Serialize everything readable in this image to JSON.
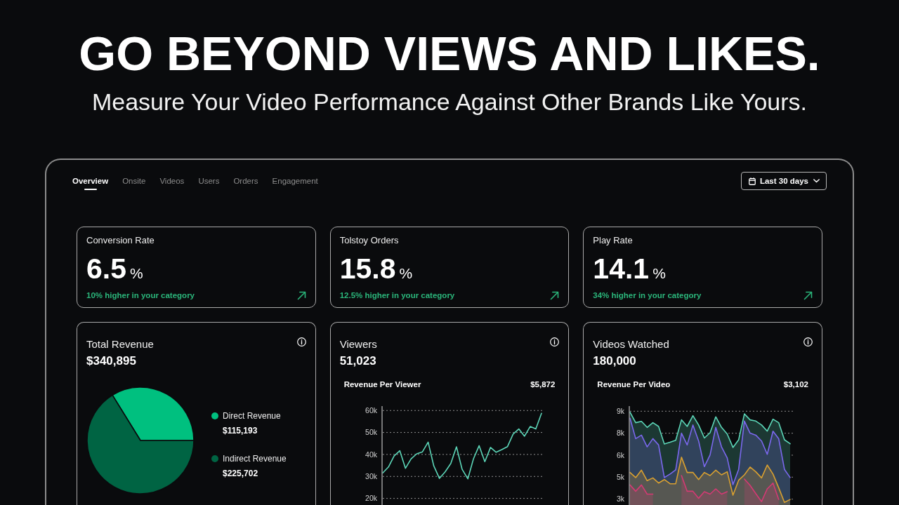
{
  "hero": {
    "title": "GO BEYOND VIEWS AND LIKES.",
    "subtitle": "Measure Your Video Performance Against Other Brands Like Yours."
  },
  "dashboard": {
    "tabs": [
      {
        "label": "Overview",
        "selected": true
      },
      {
        "label": "Onsite",
        "selected": false
      },
      {
        "label": "Videos",
        "selected": false
      },
      {
        "label": "Users",
        "selected": false
      },
      {
        "label": "Orders",
        "selected": false
      },
      {
        "label": "Engagement",
        "selected": false
      }
    ],
    "date_range": {
      "label": "Last 30 days"
    },
    "stat_cards": [
      {
        "title": "Conversion Rate",
        "value": "6.5",
        "unit": "%",
        "note": "10% higher in your category"
      },
      {
        "title": "Tolstoy Orders",
        "value": "15.8",
        "unit": "%",
        "note": "12.5% higher in your category"
      },
      {
        "title": "Play Rate",
        "value": "14.1",
        "unit": "%",
        "note": "34% higher in your category"
      }
    ],
    "chart_cards": [
      {
        "title": "Total Revenue",
        "value": "$340,895",
        "chart_data": {
          "type": "pie",
          "categories": [
            "Direct Revenue",
            "Indirect Revenue"
          ],
          "values": [
            115193,
            225702
          ],
          "value_labels": [
            "$115,193",
            "$225,702"
          ],
          "colors": [
            "#00c07f",
            "#006443"
          ],
          "legend": "right"
        }
      },
      {
        "title": "Viewers",
        "value": "51,023",
        "metric_label": "Revenue Per Viewer",
        "metric_value": "$5,872",
        "chart_data": {
          "type": "line",
          "ylim": [
            17000,
            62000
          ],
          "yticks": [
            {
              "value": 20000,
              "label": "20k"
            },
            {
              "value": 30000,
              "label": "30k"
            },
            {
              "value": 40000,
              "label": "40k"
            },
            {
              "value": 50000,
              "label": "50k"
            },
            {
              "value": 60000,
              "label": "60k"
            }
          ],
          "grid": true,
          "series": [
            {
              "color": "#5cd6b8",
              "values": [
                31600,
                34300,
                39300,
                41700,
                33700,
                38000,
                40300,
                41200,
                45600,
                34800,
                29100,
                32100,
                35900,
                43500,
                33200,
                28900,
                38000,
                44000,
                36700,
                43200,
                41000,
                42200,
                43600,
                49300,
                51600,
                48300,
                52700,
                51600,
                58700
              ]
            }
          ]
        }
      },
      {
        "title": "Videos Watched",
        "value": "180,000",
        "metric_label": "Revenue Per Video",
        "metric_value": "$3,102",
        "chart_data": {
          "type": "area",
          "ylim": [
            2600,
            9350
          ],
          "yticks": [
            {
              "value": 3000,
              "label": "3k"
            },
            {
              "value": 4500,
              "label": "5k"
            },
            {
              "value": 6000,
              "label": "6k"
            },
            {
              "value": 7500,
              "label": "8k"
            },
            {
              "value": 9000,
              "label": "9k"
            }
          ],
          "grid": true,
          "series": [
            {
              "color": "#5cd6b8",
              "values": [
                8940,
                8220,
                8310,
                7900,
                8220,
                7960,
                6770,
                6890,
                7020,
                8410,
                7960,
                8700,
                8060,
                7170,
                7530,
                8620,
                7900,
                7450,
                6530,
                7050,
                8820,
                8410,
                8330,
                8060,
                7640,
                8460,
                8220,
                7050,
                6780
              ]
            },
            {
              "color": "#7b68ee",
              "values": [
                8520,
                7130,
                7370,
                6570,
                7130,
                6700,
                4470,
                4710,
                5000,
                7500,
                6700,
                8060,
                6970,
                5220,
                6020,
                7900,
                6570,
                5810,
                3990,
                5030,
                8330,
                7500,
                7370,
                6970,
                6060,
                7640,
                7130,
                5030,
                4470
              ]
            },
            {
              "color": "#d9a030",
              "values": [
                4820,
                4470,
                4980,
                4260,
                4450,
                4100,
                4340,
                4050,
                4050,
                5860,
                4820,
                4820,
                4340,
                4820,
                4610,
                4980,
                4660,
                4870,
                3270,
                4290,
                4660,
                5190,
                4870,
                4450,
                5330,
                4710,
                3780,
                2780,
                2980
              ]
            },
            {
              "color": "#d43a74",
              "values": [
                3970,
                3540,
                3970,
                3340,
                3340,
                null,
                null,
                null,
                null,
                4610,
                3540,
                3540,
                3060,
                3510,
                3340,
                3700,
                3340,
                3510,
                null,
                null,
                4370,
                3940,
                3380,
                2830,
                3700,
                4100,
                2980,
                null,
                null
              ]
            }
          ]
        }
      }
    ]
  }
}
